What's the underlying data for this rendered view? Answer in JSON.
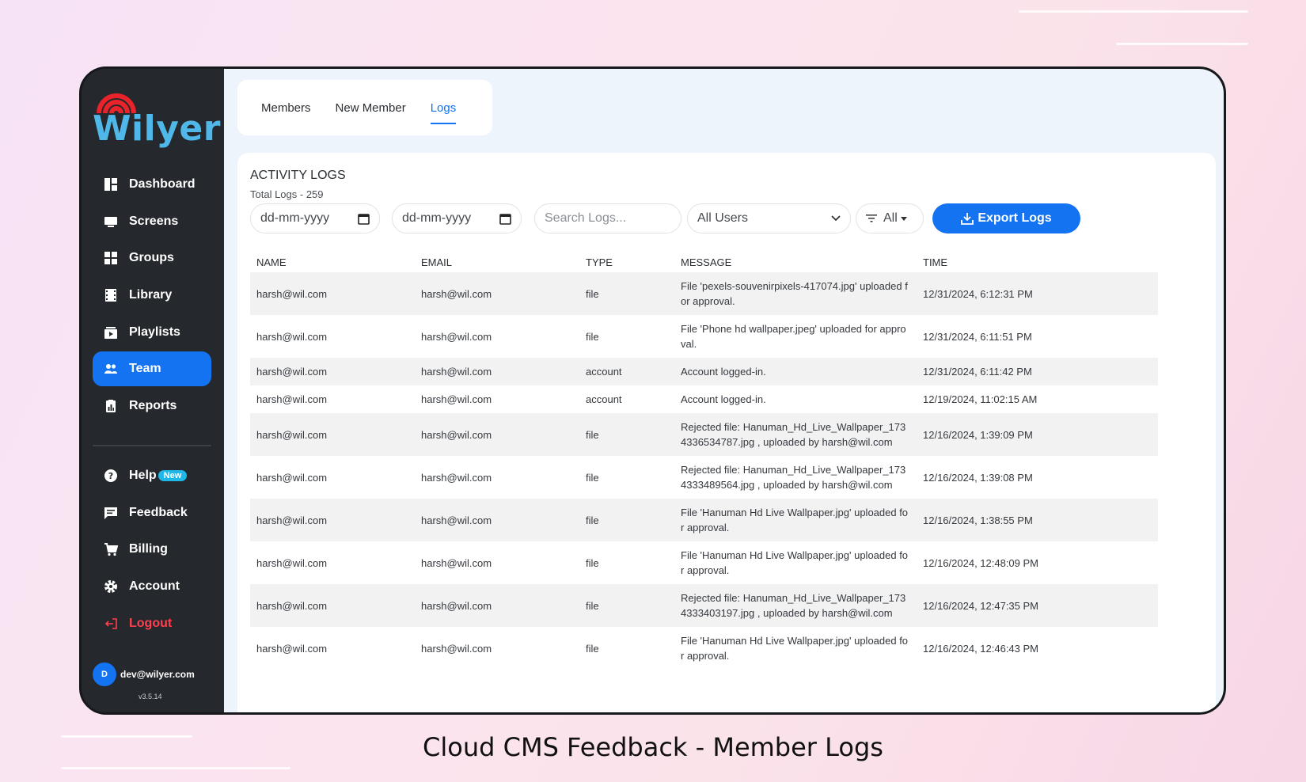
{
  "brand": {
    "name": "Wilyer",
    "accent": "#1373f0",
    "logo_color": "#4fb8e8",
    "signal_color": "#e8232a"
  },
  "sidebar": {
    "items": [
      {
        "label": "Dashboard",
        "icon": "dashboard-icon"
      },
      {
        "label": "Screens",
        "icon": "monitor-icon"
      },
      {
        "label": "Groups",
        "icon": "grid-icon"
      },
      {
        "label": "Library",
        "icon": "film-icon"
      },
      {
        "label": "Playlists",
        "icon": "playlist-icon"
      },
      {
        "label": "Team",
        "icon": "users-icon",
        "active": true
      },
      {
        "label": "Reports",
        "icon": "report-icon"
      }
    ],
    "secondary": [
      {
        "label": "Help",
        "icon": "help-icon",
        "badge": "New"
      },
      {
        "label": "Feedback",
        "icon": "feedback-icon"
      },
      {
        "label": "Billing",
        "icon": "cart-icon"
      },
      {
        "label": "Account",
        "icon": "gear-icon"
      },
      {
        "label": "Logout",
        "icon": "logout-icon"
      }
    ],
    "user": {
      "initial": "D",
      "email": "dev@wilyer.com",
      "version": "v3.5.14"
    }
  },
  "tabs": [
    {
      "label": "Members"
    },
    {
      "label": "New Member"
    },
    {
      "label": "Logs",
      "active": true
    }
  ],
  "logs": {
    "title": "ACTIVITY LOGS",
    "total": "Total Logs - 259",
    "date_from_placeholder": "dd-mm-yyyy",
    "date_to_placeholder": "dd-mm-yyyy",
    "search_placeholder": "Search Logs...",
    "user_filter": "All Users",
    "type_filter": "All",
    "export_label": "Export Logs",
    "columns": [
      "NAME",
      "EMAIL",
      "TYPE",
      "MESSAGE",
      "TIME"
    ],
    "rows": [
      {
        "name": "harsh@wil.com",
        "email": "harsh@wil.com",
        "type": "file",
        "message": "File 'pexels-souvenirpixels-417074.jpg' uploaded for approval.",
        "time": "12/31/2024, 6:12:31 PM"
      },
      {
        "name": "harsh@wil.com",
        "email": "harsh@wil.com",
        "type": "file",
        "message": "File 'Phone hd wallpaper.jpeg' uploaded for approval.",
        "time": "12/31/2024, 6:11:51 PM"
      },
      {
        "name": "harsh@wil.com",
        "email": "harsh@wil.com",
        "type": "account",
        "message": "Account logged-in.",
        "time": "12/31/2024, 6:11:42 PM"
      },
      {
        "name": "harsh@wil.com",
        "email": "harsh@wil.com",
        "type": "account",
        "message": "Account logged-in.",
        "time": "12/19/2024, 11:02:15 AM"
      },
      {
        "name": "harsh@wil.com",
        "email": "harsh@wil.com",
        "type": "file",
        "message": "Rejected file: Hanuman_Hd_Live_Wallpaper_1734336534787.jpg , uploaded by harsh@wil.com",
        "time": "12/16/2024, 1:39:09 PM"
      },
      {
        "name": "harsh@wil.com",
        "email": "harsh@wil.com",
        "type": "file",
        "message": "Rejected file: Hanuman_Hd_Live_Wallpaper_1734333489564.jpg , uploaded by harsh@wil.com",
        "time": "12/16/2024, 1:39:08 PM"
      },
      {
        "name": "harsh@wil.com",
        "email": "harsh@wil.com",
        "type": "file",
        "message": "File 'Hanuman Hd Live Wallpaper.jpg' uploaded for approval.",
        "time": "12/16/2024, 1:38:55 PM"
      },
      {
        "name": "harsh@wil.com",
        "email": "harsh@wil.com",
        "type": "file",
        "message": "File 'Hanuman Hd Live Wallpaper.jpg' uploaded for approval.",
        "time": "12/16/2024, 12:48:09 PM"
      },
      {
        "name": "harsh@wil.com",
        "email": "harsh@wil.com",
        "type": "file",
        "message": "Rejected file: Hanuman_Hd_Live_Wallpaper_1734333403197.jpg , uploaded by harsh@wil.com",
        "time": "12/16/2024, 12:47:35 PM"
      },
      {
        "name": "harsh@wil.com",
        "email": "harsh@wil.com",
        "type": "file",
        "message": "File 'Hanuman Hd Live Wallpaper.jpg' uploaded for approval.",
        "time": "12/16/2024, 12:46:43 PM"
      }
    ]
  },
  "caption": "Cloud CMS Feedback - Member Logs"
}
